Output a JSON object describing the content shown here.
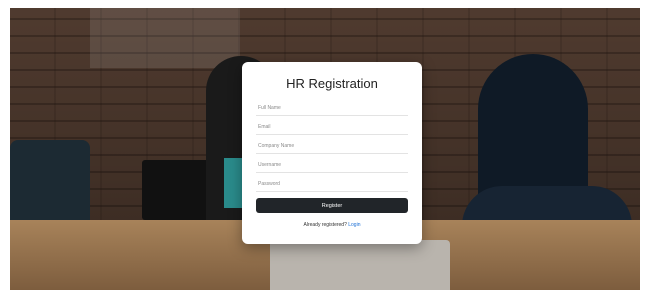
{
  "form": {
    "title": "HR Registration",
    "fields": [
      {
        "placeholder": "Full Name",
        "value": ""
      },
      {
        "placeholder": "Email",
        "value": ""
      },
      {
        "placeholder": "Company Name",
        "value": ""
      },
      {
        "placeholder": "Username",
        "value": ""
      },
      {
        "placeholder": "Password",
        "value": ""
      }
    ],
    "submit_label": "Register",
    "footer_text": "Already registered?",
    "login_link": "Login"
  },
  "colors": {
    "button_bg": "#212529",
    "link": "#1a6fd6"
  }
}
